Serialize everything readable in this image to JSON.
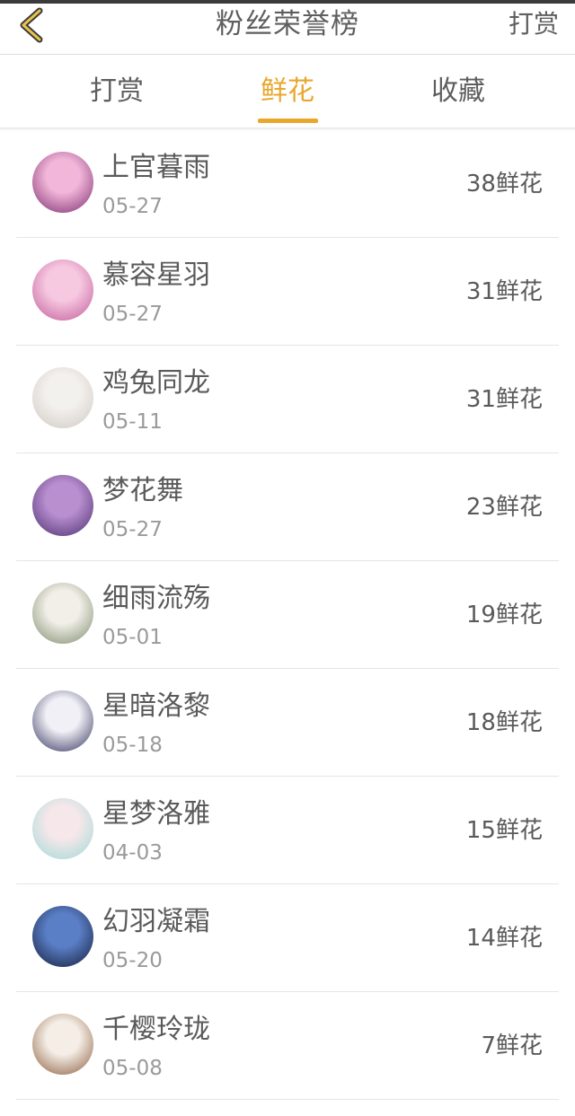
{
  "header": {
    "title": "粉丝荣誉榜",
    "action_label": "打赏"
  },
  "tabs": [
    {
      "label": "打赏",
      "active": false
    },
    {
      "label": "鲜花",
      "active": true
    },
    {
      "label": "收藏",
      "active": false
    }
  ],
  "list": {
    "unit": "鲜花",
    "items": [
      {
        "name": "上官暮雨",
        "date": "05-27",
        "count": "38",
        "avatar_colors": [
          "#f2b6d9",
          "#7a2b6e"
        ]
      },
      {
        "name": "慕容星羽",
        "date": "05-27",
        "count": "31",
        "avatar_colors": [
          "#f7c9e0",
          "#c05a9a"
        ]
      },
      {
        "name": "鸡兔同龙",
        "date": "05-11",
        "count": "31",
        "avatar_colors": [
          "#f3f1ee",
          "#cfc8c2"
        ]
      },
      {
        "name": "梦花舞",
        "date": "05-27",
        "count": "23",
        "avatar_colors": [
          "#b98fd0",
          "#4a2e6e"
        ]
      },
      {
        "name": "细雨流殇",
        "date": "05-01",
        "count": "19",
        "avatar_colors": [
          "#f2efe8",
          "#7a8a6a"
        ]
      },
      {
        "name": "星暗洛黎",
        "date": "05-18",
        "count": "18",
        "avatar_colors": [
          "#f1f0f6",
          "#2c2f5a"
        ]
      },
      {
        "name": "星梦洛雅",
        "date": "04-03",
        "count": "15",
        "avatar_colors": [
          "#f5e7ea",
          "#9fd9d6"
        ]
      },
      {
        "name": "幻羽凝霜",
        "date": "05-20",
        "count": "14",
        "avatar_colors": [
          "#5a7fc7",
          "#141b35"
        ]
      },
      {
        "name": "千樱玲珑",
        "date": "05-08",
        "count": "7",
        "avatar_colors": [
          "#f4eee6",
          "#8a5a3a"
        ]
      }
    ]
  },
  "colors": {
    "accent": "#e9a72c",
    "text": "#5a5a5a",
    "muted": "#9a9a9a"
  }
}
